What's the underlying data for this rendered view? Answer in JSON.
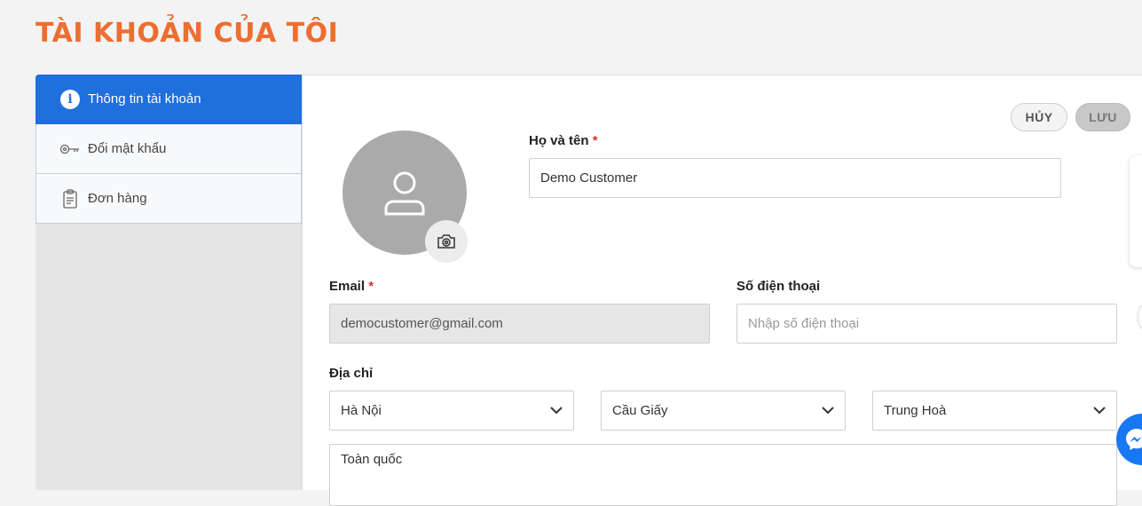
{
  "page": {
    "title": "TÀI KHOẢN CỦA TÔI"
  },
  "sidebar": {
    "items": [
      {
        "label": "Thông tin tài khoản",
        "icon": "info-icon",
        "active": true
      },
      {
        "label": "Đổi mật khẩu",
        "icon": "key-icon",
        "active": false
      },
      {
        "label": "Đơn hàng",
        "icon": "clipboard-icon",
        "active": false
      }
    ]
  },
  "actions": {
    "cancel_label": "HỦY",
    "save_label": "LƯU"
  },
  "form": {
    "fullname": {
      "label": "Họ và tên",
      "required_mark": "*",
      "value": "Demo Customer"
    },
    "email": {
      "label": "Email",
      "required_mark": "*",
      "value": "democustomer@gmail.com"
    },
    "phone": {
      "label": "Số điện thoại",
      "placeholder": "Nhập số điện thoại"
    },
    "address": {
      "label": "Địa chỉ",
      "province": "Hà Nội",
      "district": "Cầu Giấy",
      "ward": "Trung Hoà",
      "detail": "Toàn quốc"
    }
  },
  "colors": {
    "accent": "#ec6e31",
    "active_nav": "#1f6fde",
    "required": "#e03131",
    "messenger": "#1877f2"
  },
  "icons": {
    "avatar": "user-icon",
    "camera": "camera-icon",
    "select": "chevron-down-icon",
    "chat": "messenger-icon"
  }
}
